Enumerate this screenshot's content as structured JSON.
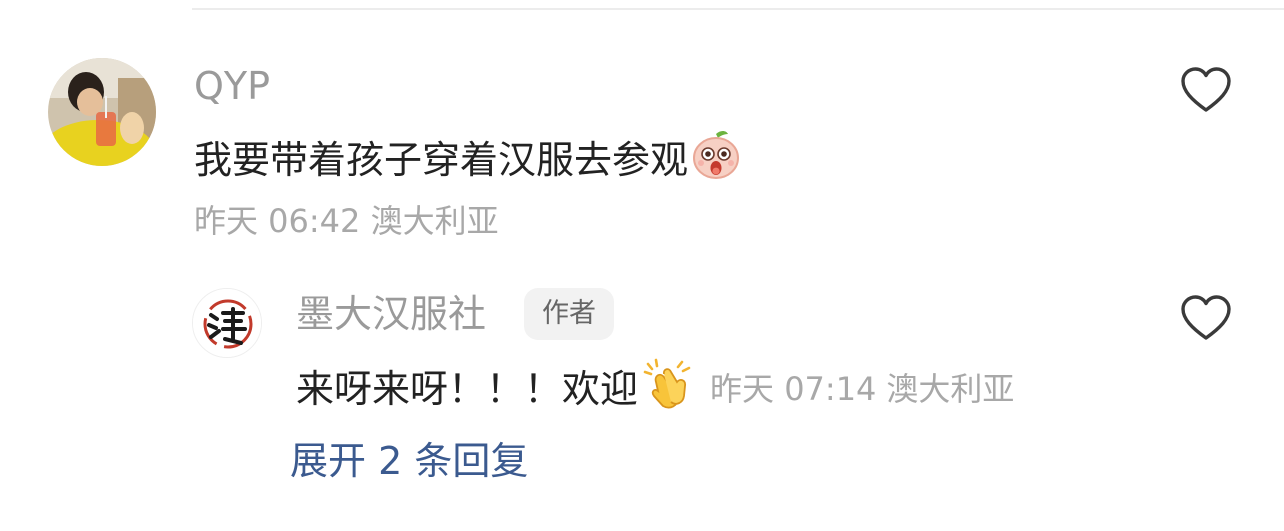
{
  "comment": {
    "username": "QYP",
    "text": "我要带着孩子穿着汉服去参观",
    "emoji": "face-emoji-icon",
    "time": "昨天 06:42",
    "location": "澳大利亚"
  },
  "reply": {
    "username": "墨大汉服社",
    "author_badge": "作者",
    "text": "来呀来呀！！！欢迎",
    "emoji": "clapping-hands-icon",
    "time": "昨天 07:14",
    "location": "澳大利亚",
    "avatar_logo_text": "漢"
  },
  "expand_replies": "展开 2 条回复",
  "colors": {
    "link": "#3b5a8f",
    "secondary_text": "#9a9a9a",
    "primary_text": "#222222",
    "badge_bg": "#f2f2f2"
  }
}
